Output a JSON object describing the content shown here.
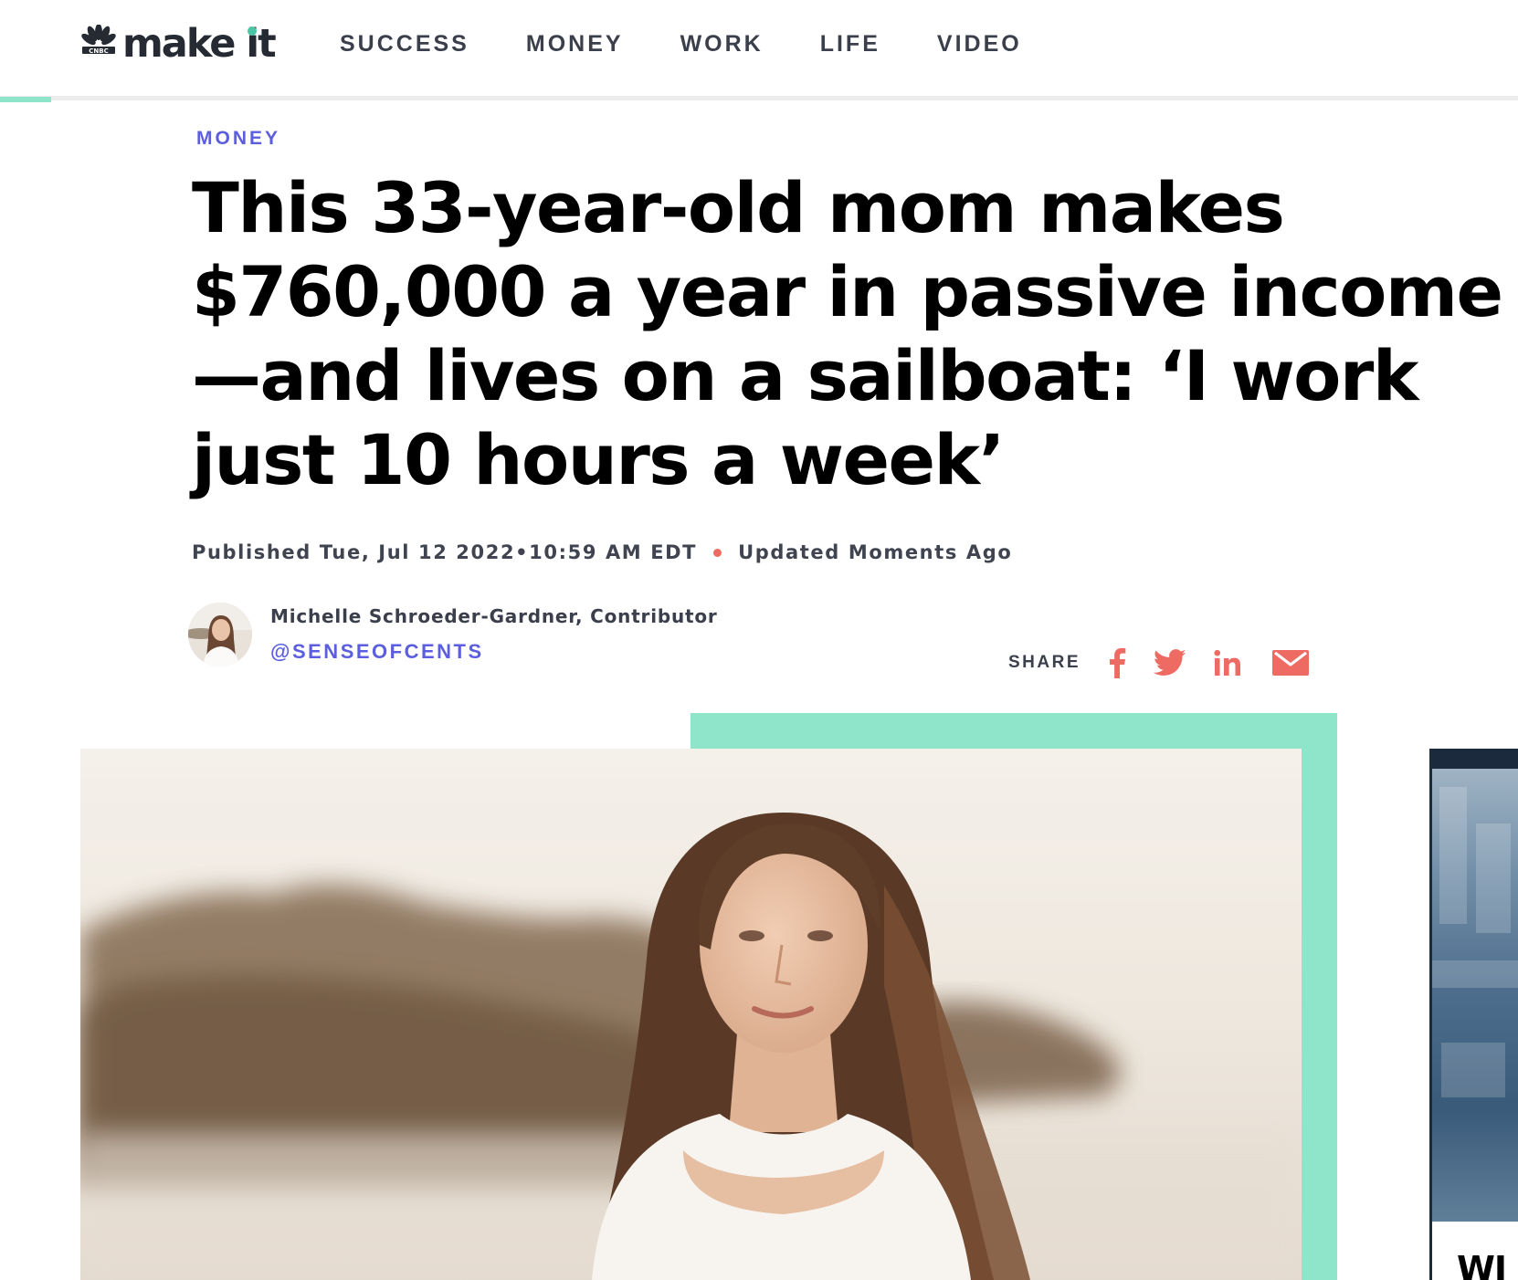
{
  "brand": {
    "network": "CNBC",
    "name_prefix": "make ",
    "name_i": "i",
    "name_suffix": "t",
    "accent_color": "#4ac6a3"
  },
  "nav": {
    "items": [
      {
        "label": "SUCCESS"
      },
      {
        "label": "MONEY"
      },
      {
        "label": "WORK"
      },
      {
        "label": "LIFE"
      },
      {
        "label": "VIDEO"
      }
    ]
  },
  "article": {
    "section": "MONEY",
    "headline": "This 33-year-old mom makes $760,000 a year in passive income—and lives on a sailboat: ‘I work just 10 hours a week’",
    "published": "Published Tue, Jul 12 2022•10:59 AM EDT",
    "updated": "Updated Moments Ago",
    "author": {
      "name": "Michelle Schroeder-Gardner, Contributor",
      "handle": "@SENSEOFCENTS"
    },
    "share": {
      "label": "SHARE",
      "buttons": [
        {
          "icon": "facebook-icon"
        },
        {
          "icon": "twitter-icon"
        },
        {
          "icon": "linkedin-icon"
        },
        {
          "icon": "email-icon"
        }
      ]
    }
  },
  "side_promo": {
    "caption": "WI"
  },
  "colors": {
    "section_link": "#5c5ee0",
    "share_icons": "#ee6b63",
    "accent_block": "#8fe5c9"
  }
}
